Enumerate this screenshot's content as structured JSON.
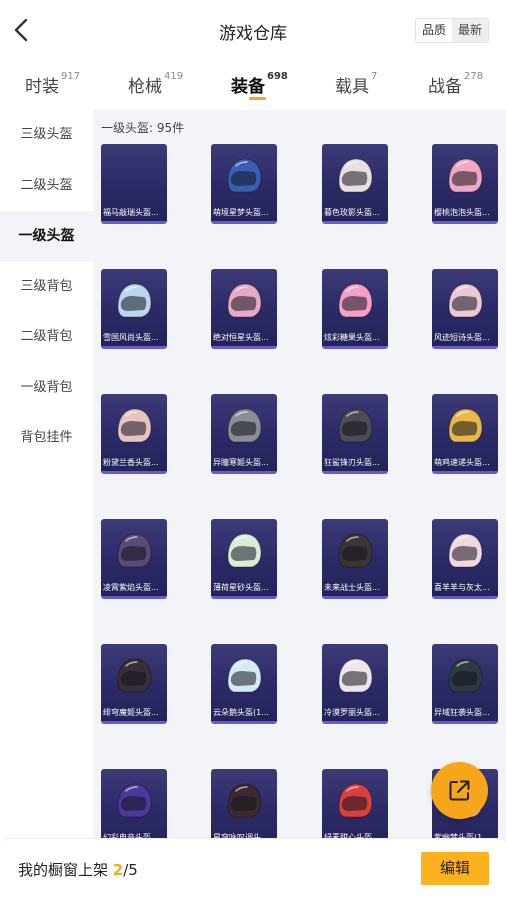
{
  "header": {
    "title": "游戏仓库",
    "sort_options": [
      {
        "label": "品质",
        "active": false
      },
      {
        "label": "最新",
        "active": true
      }
    ]
  },
  "tabs": [
    {
      "label": "时装",
      "count": "917",
      "active": false
    },
    {
      "label": "枪械",
      "count": "419",
      "active": false
    },
    {
      "label": "装备",
      "count": "698",
      "active": true
    },
    {
      "label": "载具",
      "count": "7",
      "active": false
    },
    {
      "label": "战备",
      "count": "278",
      "active": false
    }
  ],
  "sidebar": {
    "items": [
      {
        "label": "三级头盔",
        "active": false
      },
      {
        "label": "二级头盔",
        "active": false
      },
      {
        "label": "一级头盔",
        "active": true
      },
      {
        "label": "三级背包",
        "active": false
      },
      {
        "label": "二级背包",
        "active": false
      },
      {
        "label": "一级背包",
        "active": false
      },
      {
        "label": "背包挂件",
        "active": false
      }
    ]
  },
  "content": {
    "section_label": "一级头盔: 95件",
    "items": [
      {
        "name": "福马敲瑞头盔...",
        "icon": "helmet-icon",
        "color": "none"
      },
      {
        "name": "萌境星梦头盔...",
        "icon": "helmet-icon",
        "color": "#3a5fb0"
      },
      {
        "name": "暮色玫影头盔...",
        "icon": "helmet-icon",
        "color": "#e8e0e0"
      },
      {
        "name": "樱桃泡泡头盔...",
        "icon": "helmet-icon",
        "color": "#f0a8c4"
      },
      {
        "name": "雪国风尚头盔...",
        "icon": "helmet-icon",
        "color": "#bcd6f0"
      },
      {
        "name": "绝对恒星头盔...",
        "icon": "helmet-icon",
        "color": "#e6a9c6"
      },
      {
        "name": "炫彩糖果头盔...",
        "icon": "helmet-icon",
        "color": "#f2a0c8"
      },
      {
        "name": "风迹短诗头盔...",
        "icon": "helmet-icon",
        "color": "#e9c9d4"
      },
      {
        "name": "粉黛兰香头盔...",
        "icon": "helmet-icon",
        "color": "#e6c4c4"
      },
      {
        "name": "异瞳寒姬头盔...",
        "icon": "helmet-icon",
        "color": "#8a8f96"
      },
      {
        "name": "狂鲨锋刃头盔...",
        "icon": "helmet-icon",
        "color": "#4a4d55"
      },
      {
        "name": "萌鸡速递头盔...",
        "icon": "helmet-icon",
        "color": "#e9b84a"
      },
      {
        "name": "凌霄紫焰头盔...",
        "icon": "helmet-icon",
        "color": "#5a4a78"
      },
      {
        "name": "薄荷星砂头盔...",
        "icon": "helmet-icon",
        "color": "#d8ecd8"
      },
      {
        "name": "未来战士头盔...",
        "icon": "helmet-icon",
        "color": "#3b3633"
      },
      {
        "name": "喜羊羊与灰太...",
        "icon": "helmet-icon",
        "color": "#f0d8e0"
      },
      {
        "name": "绯穹魔姬头盔...",
        "icon": "helmet-icon",
        "color": "#3a2e3a"
      },
      {
        "name": "云朵鹅头盔(1...",
        "icon": "helmet-icon",
        "color": "#d4eaf6"
      },
      {
        "name": "冷漠罗丽头盔...",
        "icon": "helmet-icon",
        "color": "#ece6ea"
      },
      {
        "name": "异域狂袭头盔...",
        "icon": "helmet-icon",
        "color": "#2e3944"
      },
      {
        "name": "幻彩电音头盔...",
        "icon": "helmet-icon",
        "color": "#4b3a9a"
      },
      {
        "name": "星穹咏叹调头...",
        "icon": "helmet-icon",
        "color": "#3a2a30"
      },
      {
        "name": "绿素甜心头盔...",
        "icon": "helmet-icon",
        "color": "#d84040"
      },
      {
        "name": "紫幽梦头盔(1...",
        "icon": "helmet-icon",
        "color": "#f0c8d8"
      }
    ]
  },
  "fab": {
    "icon": "share-icon"
  },
  "bottom_bar": {
    "showcase_prefix": "我的橱窗上架 ",
    "showcase_current": "2",
    "showcase_sep_total": "/5",
    "edit_label": "编辑"
  },
  "colors": {
    "accent": "#f6a623",
    "card_bg": "#2c2a66",
    "content_bg": "#f2f4f7"
  }
}
